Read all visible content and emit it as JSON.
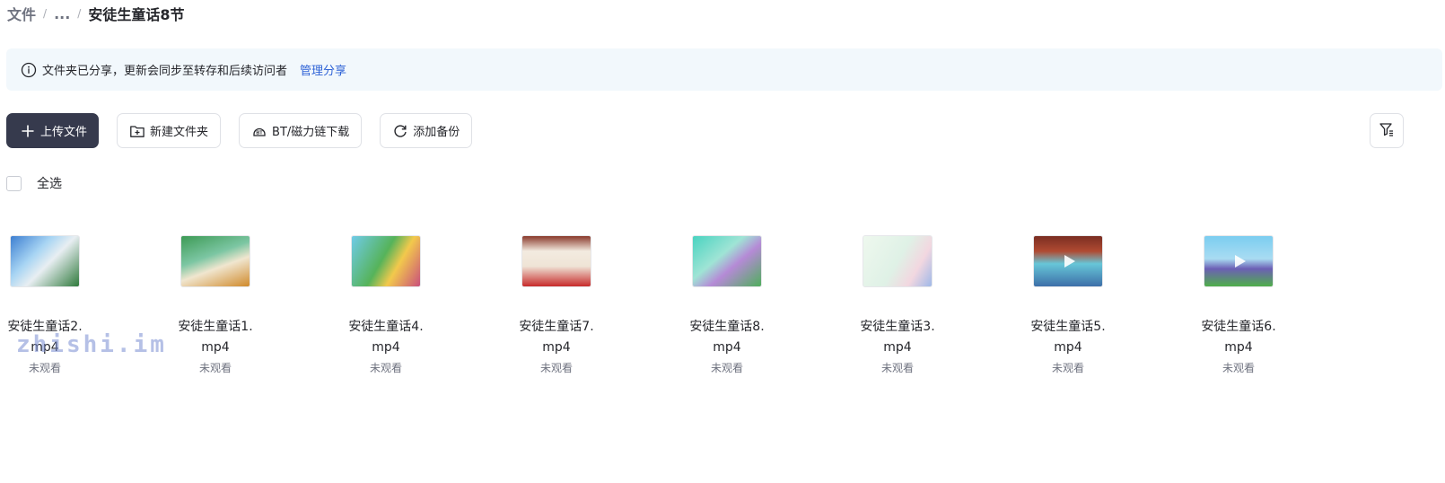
{
  "breadcrumb": {
    "root": "文件",
    "separator": "/",
    "ellipsis": "...",
    "current": "安徒生童话8节"
  },
  "notice": {
    "text": "文件夹已分享，更新会同步至转存和后续访问者",
    "link": "管理分享",
    "link_color": "#2f63d6"
  },
  "toolbar": {
    "upload": "上传文件",
    "new_folder": "新建文件夹",
    "bt_download": "BT/磁力链下载",
    "add_backup": "添加备份"
  },
  "select_all": "全选",
  "files": [
    {
      "name_line1": "安徒生童话2.",
      "name_line2": "mp4",
      "status": "未观看"
    },
    {
      "name_line1": "安徒生童话1.",
      "name_line2": "mp4",
      "status": "未观看"
    },
    {
      "name_line1": "安徒生童话4.",
      "name_line2": "mp4",
      "status": "未观看"
    },
    {
      "name_line1": "安徒生童话7.",
      "name_line2": "mp4",
      "status": "未观看"
    },
    {
      "name_line1": "安徒生童话8.",
      "name_line2": "mp4",
      "status": "未观看"
    },
    {
      "name_line1": "安徒生童话3.",
      "name_line2": "mp4",
      "status": "未观看"
    },
    {
      "name_line1": "安徒生童话5.",
      "name_line2": "mp4",
      "status": "未观看"
    },
    {
      "name_line1": "安徒生童话6.",
      "name_line2": "mp4",
      "status": "未观看"
    }
  ],
  "watermark": "zhishi.im",
  "colors": {
    "primary_button": "#363a4d",
    "notice_bg": "#f2f8fc",
    "link": "#2f63d6"
  }
}
